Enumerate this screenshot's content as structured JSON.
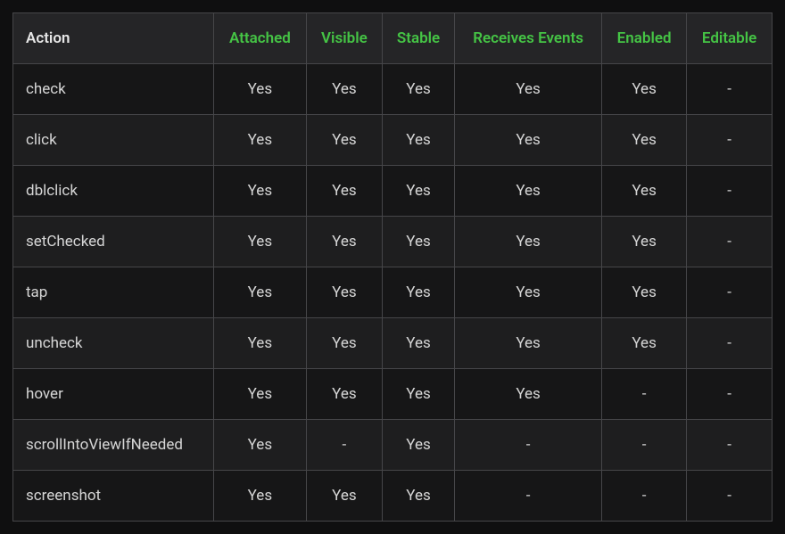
{
  "table": {
    "headers": [
      "Action",
      "Attached",
      "Visible",
      "Stable",
      "Receives Events",
      "Enabled",
      "Editable"
    ],
    "rows": [
      {
        "cells": [
          "check",
          "Yes",
          "Yes",
          "Yes",
          "Yes",
          "Yes",
          "-"
        ]
      },
      {
        "cells": [
          "click",
          "Yes",
          "Yes",
          "Yes",
          "Yes",
          "Yes",
          "-"
        ]
      },
      {
        "cells": [
          "dblclick",
          "Yes",
          "Yes",
          "Yes",
          "Yes",
          "Yes",
          "-"
        ]
      },
      {
        "cells": [
          "setChecked",
          "Yes",
          "Yes",
          "Yes",
          "Yes",
          "Yes",
          "-"
        ]
      },
      {
        "cells": [
          "tap",
          "Yes",
          "Yes",
          "Yes",
          "Yes",
          "Yes",
          "-"
        ]
      },
      {
        "cells": [
          "uncheck",
          "Yes",
          "Yes",
          "Yes",
          "Yes",
          "Yes",
          "-"
        ]
      },
      {
        "cells": [
          "hover",
          "Yes",
          "Yes",
          "Yes",
          "Yes",
          "-",
          "-"
        ]
      },
      {
        "cells": [
          "scrollIntoViewIfNeeded",
          "Yes",
          "-",
          "Yes",
          "-",
          "-",
          "-"
        ]
      },
      {
        "cells": [
          "screenshot",
          "Yes",
          "Yes",
          "Yes",
          "-",
          "-",
          "-"
        ]
      }
    ]
  }
}
